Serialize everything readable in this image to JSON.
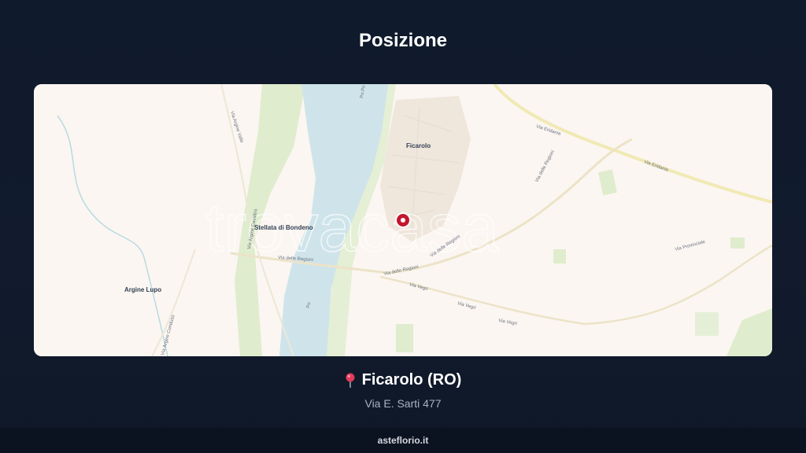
{
  "header": {
    "title": "Posizione"
  },
  "map": {
    "watermark": "trovacasa",
    "places": {
      "ficarolo": "Ficarolo",
      "stellata": "Stellata di Bondeno",
      "argine_lupo": "Argine Lupo"
    },
    "roads": {
      "via_eridania_1": "Via Eridania",
      "via_eridania_2": "Via Eridania",
      "via_delle_regioni_1": "Via delle Regioni",
      "via_delle_regioni_2": "Via delle Regioni",
      "via_delle_regioni_3": "Via delle Regioni",
      "via_delle_regioni_4": "Via delle Regioni",
      "via_vegri_1": "Via Vegri",
      "via_vegri_2": "Via Vegri",
      "via_vegri_3": "Via Vegri",
      "via_provinciale": "Via Provinciale",
      "via_argine_valle": "Via Argine Valle",
      "via_argine_cavallini": "Via Argine Cavallini",
      "via_argine_conduso": "Via Argine Conduso",
      "po_1": "Po Po",
      "po_2": "Po"
    },
    "marker_icon": "location-marker-icon"
  },
  "location": {
    "name": "Ficarolo (RO)",
    "address": "Via E. Sarti 477",
    "pin_icon": "pin-icon",
    "pin_color": "#e23a5b"
  },
  "footer": {
    "brand": "asteflorio.it"
  },
  "colors": {
    "background": "#111b2d",
    "river": "#cfe4ea",
    "land": "#fbf6f1",
    "green": "#dfeccd",
    "road": "#f1e9b4",
    "marker": "#c4162e"
  }
}
